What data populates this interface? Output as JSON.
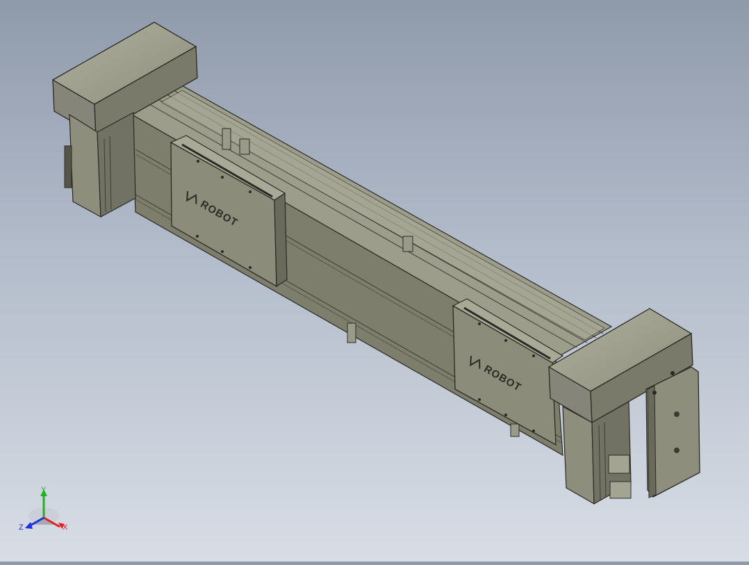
{
  "viewport": {
    "title": ""
  },
  "model": {
    "carriage_1": {
      "brand": "ROBOT"
    },
    "carriage_2": {
      "brand": "ROBOT"
    }
  },
  "triad": {
    "x_label": "X",
    "y_label": "Y",
    "z_label": "Z"
  },
  "colors": {
    "body_main": "#8a8a78",
    "body_light": "#a4a492",
    "body_dark": "#5f5f52",
    "edge": "#2a2a24",
    "background_top": "#8f9aab",
    "background_bottom": "#d8dde5",
    "axis_x": "#e02020",
    "axis_y": "#20b020",
    "axis_z": "#2030e0"
  },
  "icons": [
    "coordinate-triad-icon",
    "logo-icon"
  ]
}
